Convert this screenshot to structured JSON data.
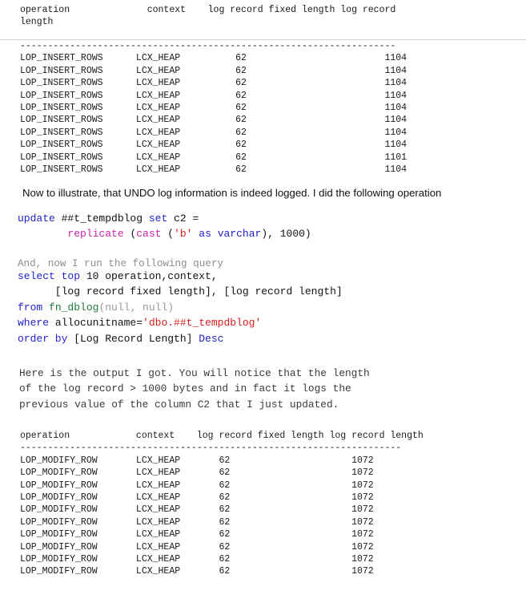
{
  "document": {
    "type": "technical-blog-article",
    "topic": "SQL Server tempdb transaction log records"
  },
  "table1": {
    "name": "insert-rows-log-output",
    "headers": [
      "operation",
      "context",
      "log record fixed length",
      "log record length"
    ],
    "header_line1": "operation              context    log record fixed length log record",
    "header_line2": "length",
    "separator": "--------------------------------------------------------------------",
    "rows": [
      {
        "operation": "LOP_INSERT_ROWS",
        "context": "LCX_HEAP",
        "fixed_length": "62",
        "record_length": "1104"
      },
      {
        "operation": "LOP_INSERT_ROWS",
        "context": "LCX_HEAP",
        "fixed_length": "62",
        "record_length": "1104"
      },
      {
        "operation": "LOP_INSERT_ROWS",
        "context": "LCX_HEAP",
        "fixed_length": "62",
        "record_length": "1104"
      },
      {
        "operation": "LOP_INSERT_ROWS",
        "context": "LCX_HEAP",
        "fixed_length": "62",
        "record_length": "1104"
      },
      {
        "operation": "LOP_INSERT_ROWS",
        "context": "LCX_HEAP",
        "fixed_length": "62",
        "record_length": "1104"
      },
      {
        "operation": "LOP_INSERT_ROWS",
        "context": "LCX_HEAP",
        "fixed_length": "62",
        "record_length": "1104"
      },
      {
        "operation": "LOP_INSERT_ROWS",
        "context": "LCX_HEAP",
        "fixed_length": "62",
        "record_length": "1104"
      },
      {
        "operation": "LOP_INSERT_ROWS",
        "context": "LCX_HEAP",
        "fixed_length": "62",
        "record_length": "1104"
      },
      {
        "operation": "LOP_INSERT_ROWS",
        "context": "LCX_HEAP",
        "fixed_length": "62",
        "record_length": "1101"
      },
      {
        "operation": "LOP_INSERT_ROWS",
        "context": "LCX_HEAP",
        "fixed_length": "62",
        "record_length": "1104"
      }
    ],
    "text": "LOP_INSERT_ROWS      LCX_HEAP          62                         1104\nLOP_INSERT_ROWS      LCX_HEAP          62                         1104\nLOP_INSERT_ROWS      LCX_HEAP          62                         1104\nLOP_INSERT_ROWS      LCX_HEAP          62                         1104\nLOP_INSERT_ROWS      LCX_HEAP          62                         1104\nLOP_INSERT_ROWS      LCX_HEAP          62                         1104\nLOP_INSERT_ROWS      LCX_HEAP          62                         1104\nLOP_INSERT_ROWS      LCX_HEAP          62                         1104\nLOP_INSERT_ROWS      LCX_HEAP          62                         1101\nLOP_INSERT_ROWS      LCX_HEAP          62                         1104"
  },
  "paragraph1": "Now to illustrate, that UNDO log information is indeed logged. I did the following operation",
  "code_update": {
    "line1_kw1": "update",
    "line1_table": " ##t_tempdblog ",
    "line1_kw2": "set",
    "line1_col": " c2 =",
    "line2_indent": "        ",
    "line2_fn1": "replicate",
    "line2_paren1": " (",
    "line2_fn2": "cast",
    "line2_paren2": " (",
    "line2_str": "'b'",
    "line2_kw_as": " as ",
    "line2_kw_varchar": "varchar",
    "line2_tail": "), 1000)"
  },
  "paragraph2": "And, now I run the following query",
  "code_select": {
    "l1_kw_select": "select",
    "l1_kw_top": " top",
    "l1_rest": " 10 operation,context,",
    "l2": "      [log record fixed length], [log record length]",
    "l3_kw_from": "from",
    "l3_fn": " fn_dblog",
    "l3_args": "(null, null)",
    "l4_kw_where": "where",
    "l4_col": " allocunitname=",
    "l4_str": "'dbo.##t_tempdblog'",
    "l5_kw_order": "order by",
    "l5_col": " [Log Record Length] ",
    "l5_kw_desc": "Desc"
  },
  "paragraph3": "Here is the output I got. You will notice that the length\nof the log record > 1000 bytes and in fact it logs the\nprevious value of the column C2 that I just updated.",
  "table2": {
    "name": "modify-row-log-output",
    "headers": [
      "operation",
      "context",
      "log record fixed length",
      "log record length"
    ],
    "header_line": "operation            context    log record fixed length log record length",
    "separator": "---------------------------------------------------------------------",
    "rows": [
      {
        "operation": "LOP_MODIFY_ROW",
        "context": "LCX_HEAP",
        "fixed_length": "62",
        "record_length": "1072"
      },
      {
        "operation": "LOP_MODIFY_ROW",
        "context": "LCX_HEAP",
        "fixed_length": "62",
        "record_length": "1072"
      },
      {
        "operation": "LOP_MODIFY_ROW",
        "context": "LCX_HEAP",
        "fixed_length": "62",
        "record_length": "1072"
      },
      {
        "operation": "LOP_MODIFY_ROW",
        "context": "LCX_HEAP",
        "fixed_length": "62",
        "record_length": "1072"
      },
      {
        "operation": "LOP_MODIFY_ROW",
        "context": "LCX_HEAP",
        "fixed_length": "62",
        "record_length": "1072"
      },
      {
        "operation": "LOP_MODIFY_ROW",
        "context": "LCX_HEAP",
        "fixed_length": "62",
        "record_length": "1072"
      },
      {
        "operation": "LOP_MODIFY_ROW",
        "context": "LCX_HEAP",
        "fixed_length": "62",
        "record_length": "1072"
      },
      {
        "operation": "LOP_MODIFY_ROW",
        "context": "LCX_HEAP",
        "fixed_length": "62",
        "record_length": "1072"
      },
      {
        "operation": "LOP_MODIFY_ROW",
        "context": "LCX_HEAP",
        "fixed_length": "62",
        "record_length": "1072"
      },
      {
        "operation": "LOP_MODIFY_ROW",
        "context": "LCX_HEAP",
        "fixed_length": "62",
        "record_length": "1072"
      }
    ],
    "text": "LOP_MODIFY_ROW       LCX_HEAP       62                      1072\nLOP_MODIFY_ROW       LCX_HEAP       62                      1072\nLOP_MODIFY_ROW       LCX_HEAP       62                      1072\nLOP_MODIFY_ROW       LCX_HEAP       62                      1072\nLOP_MODIFY_ROW       LCX_HEAP       62                      1072\nLOP_MODIFY_ROW       LCX_HEAP       62                      1072\nLOP_MODIFY_ROW       LCX_HEAP       62                      1072\nLOP_MODIFY_ROW       LCX_HEAP       62                      1072\nLOP_MODIFY_ROW       LCX_HEAP       62                      1072\nLOP_MODIFY_ROW       LCX_HEAP       62                      1072"
  },
  "colors": {
    "keyword": "#2222cc",
    "function": "#cc22aa",
    "table_function": "#1f7a3d",
    "string": "#d81c1c",
    "dim": "#9a9a9a",
    "text": "#111111"
  }
}
